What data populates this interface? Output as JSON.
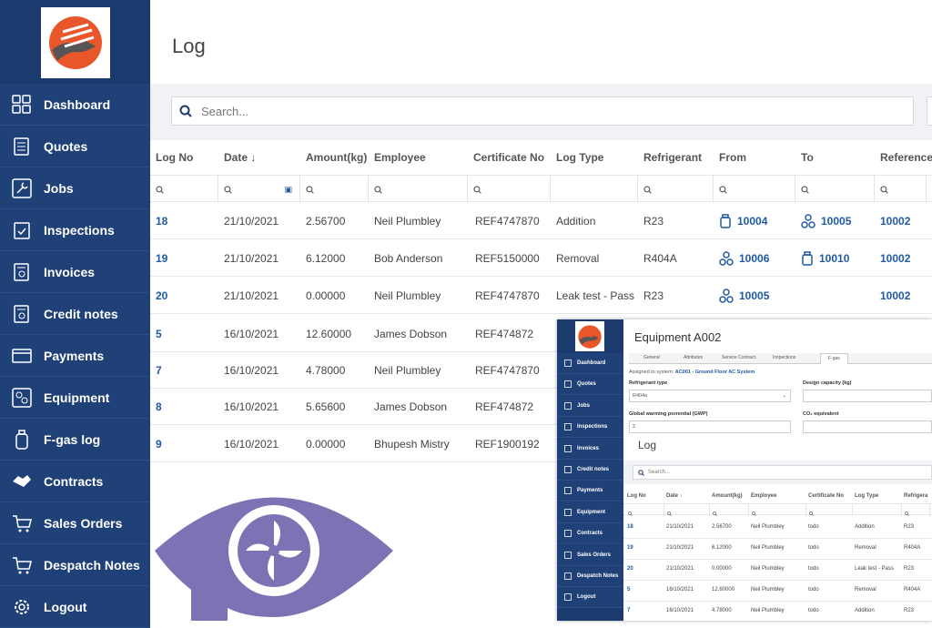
{
  "sidebar": {
    "items": [
      {
        "label": "Dashboard",
        "icon": "dashboard-icon"
      },
      {
        "label": "Quotes",
        "icon": "quotes-icon"
      },
      {
        "label": "Jobs",
        "icon": "wrench-icon"
      },
      {
        "label": "Inspections",
        "icon": "checklist-icon"
      },
      {
        "label": "Invoices",
        "icon": "invoice-icon"
      },
      {
        "label": "Credit notes",
        "icon": "credit-note-icon"
      },
      {
        "label": "Payments",
        "icon": "payment-icon"
      },
      {
        "label": "Equipment",
        "icon": "equipment-icon"
      },
      {
        "label": "F-gas log",
        "icon": "gas-cylinder-icon"
      },
      {
        "label": "Contracts",
        "icon": "handshake-icon"
      },
      {
        "label": "Sales Orders",
        "icon": "cart-icon"
      },
      {
        "label": "Despatch Notes",
        "icon": "cart-icon"
      },
      {
        "label": "Logout",
        "icon": "gear-icon"
      }
    ]
  },
  "header": {
    "title": "Log"
  },
  "search": {
    "placeholder": "Search..."
  },
  "table": {
    "columns": [
      "Log No",
      "Date ↓",
      "Amount(kg)",
      "Employee",
      "Certificate No",
      "Log Type",
      "Refrigerant",
      "From",
      "To",
      "Reference"
    ],
    "rows": [
      {
        "log_no": "18",
        "date": "21/10/2021",
        "amount": "2.56700",
        "employee": "Neil Plumbley",
        "cert": "REF4747870",
        "type": "Addition",
        "refrigerant": "R23",
        "from": "10004",
        "from_icon": "cylinder",
        "to": "10005",
        "to_icon": "unit",
        "reference": "10002"
      },
      {
        "log_no": "19",
        "date": "21/10/2021",
        "amount": "6.12000",
        "employee": "Bob Anderson",
        "cert": "REF5150000",
        "type": "Removal",
        "refrigerant": "R404A",
        "from": "10006",
        "from_icon": "unit",
        "to": "10010",
        "to_icon": "cylinder",
        "reference": "10002"
      },
      {
        "log_no": "20",
        "date": "21/10/2021",
        "amount": "0.00000",
        "employee": "Neil Plumbley",
        "cert": "REF4747870",
        "type": "Leak test - Pass",
        "refrigerant": "R23",
        "from": "10005",
        "from_icon": "unit",
        "to": "",
        "to_icon": "",
        "reference": "10002"
      },
      {
        "log_no": "5",
        "date": "16/10/2021",
        "amount": "12.60000",
        "employee": "James Dobson",
        "cert": "REF474872",
        "type": "",
        "refrigerant": "",
        "from": "",
        "from_icon": "",
        "to": "",
        "to_icon": "",
        "reference": ""
      },
      {
        "log_no": "7",
        "date": "16/10/2021",
        "amount": "4.78000",
        "employee": "Neil Plumbley",
        "cert": "REF4747870",
        "type": "",
        "refrigerant": "",
        "from": "",
        "from_icon": "",
        "to": "",
        "to_icon": "",
        "reference": ""
      },
      {
        "log_no": "8",
        "date": "16/10/2021",
        "amount": "5.65600",
        "employee": "James Dobson",
        "cert": "REF474872",
        "type": "",
        "refrigerant": "",
        "from": "",
        "from_icon": "",
        "to": "",
        "to_icon": "",
        "reference": ""
      },
      {
        "log_no": "9",
        "date": "16/10/2021",
        "amount": "0.00000",
        "employee": "Bhupesh Mistry",
        "cert": "REF1900192",
        "type": "",
        "refrigerant": "",
        "from": "",
        "from_icon": "",
        "to": "",
        "to_icon": "",
        "reference": ""
      }
    ]
  },
  "overlay": {
    "sidebar": [
      "Dashboard",
      "Quotes",
      "Jobs",
      "Inspections",
      "Invoices",
      "Credit notes",
      "Payments",
      "Equipment",
      "Contracts",
      "Sales Orders",
      "Despatch Notes",
      "Logout"
    ],
    "title": "Equipment A002",
    "tabs": [
      "General",
      "Attributes",
      "Service Contract",
      "Inspections",
      "F-gas"
    ],
    "assigned_prefix": "Assigned to system:",
    "assigned_link": "AC001 - Ground Floor AC System",
    "refrigerant_type_label": "Refrigerant type",
    "refrigerant_type_value": "R404a",
    "design_capacity_label": "Design capacity (kg)",
    "gwp_label": "Global warming porrential (GWP)",
    "gwp_value": "2",
    "co2_label": "CO₂ equivalent",
    "log_title": "Log",
    "search_placeholder": "Search...",
    "columns": [
      "Log No",
      "Date ↓",
      "Amount(kg)",
      "Employee",
      "Certificate No",
      "Log Type",
      "Refrigera"
    ],
    "rows": [
      {
        "log_no": "18",
        "date": "21/10/2021",
        "amount": "2.56700",
        "employee": "Neil Plumbley",
        "cert": "todo",
        "type": "Addition",
        "refrigerant": "R23"
      },
      {
        "log_no": "19",
        "date": "21/10/2021",
        "amount": "6.12000",
        "employee": "Neil Plumbley",
        "cert": "todo",
        "type": "Removal",
        "refrigerant": "R404A"
      },
      {
        "log_no": "20",
        "date": "21/10/2021",
        "amount": "0.00000",
        "employee": "Neil Plumbley",
        "cert": "todo",
        "type": "Leak test - Pass",
        "refrigerant": "R23"
      },
      {
        "log_no": "5",
        "date": "16/10/2021",
        "amount": "12.60000",
        "employee": "Neil Plumbley",
        "cert": "todo",
        "type": "Removal",
        "refrigerant": "R404A"
      },
      {
        "log_no": "7",
        "date": "16/10/2021",
        "amount": "4.78000",
        "employee": "Neil Plumbley",
        "cert": "todo",
        "type": "Addition",
        "refrigerant": "R23"
      }
    ]
  },
  "colors": {
    "sidebar": "#1f4178",
    "link": "#1f5aa6",
    "brand_purple": "#7b73b3",
    "logo_orange": "#e8562a"
  }
}
